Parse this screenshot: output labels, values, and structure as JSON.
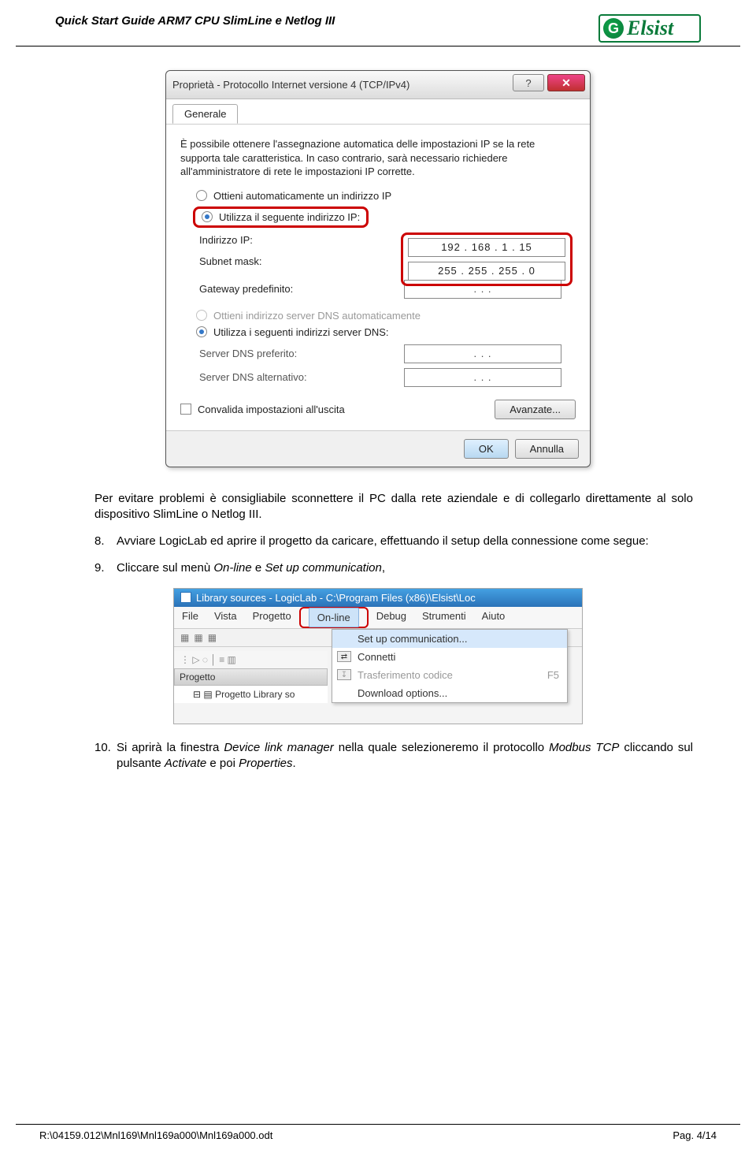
{
  "header": {
    "title": "Quick Start Guide ARM7 CPU SlimLine e Netlog III",
    "logo_text": "Elsist"
  },
  "dialog": {
    "title": "Proprietà - Protocollo Internet versione 4 (TCP/IPv4)",
    "tab": "Generale",
    "description": "È possibile ottenere l'assegnazione automatica delle impostazioni IP se la rete supporta tale caratteristica. In caso contrario, sarà necessario richiedere all'amministratore di rete le impostazioni IP corrette.",
    "radio_auto_ip": "Ottieni automaticamente un indirizzo IP",
    "radio_manual_ip": "Utilizza il seguente indirizzo IP:",
    "ip_label": "Indirizzo IP:",
    "ip_value": "192 . 168 .   1  .  15",
    "mask_label": "Subnet mask:",
    "mask_value": "255 . 255 . 255 .   0",
    "gw_label": "Gateway predefinito:",
    "gw_value": ".       .       .",
    "radio_auto_dns": "Ottieni indirizzo server DNS automaticamente",
    "radio_manual_dns": "Utilizza i seguenti indirizzi server DNS:",
    "dns1_label": "Server DNS preferito:",
    "dns1_value": ".       .       .",
    "dns2_label": "Server DNS alternativo:",
    "dns2_value": ".       .       .",
    "validate": "Convalida impostazioni all'uscita",
    "advanced": "Avanzate...",
    "ok": "OK",
    "cancel": "Annulla"
  },
  "para": {
    "p1a": "Per evitare problemi è consigliabile sconnettere il PC dalla rete aziendale e di collegarlo direttamente al solo dispositivo SlimLine o Netlog III.",
    "p8": "Avviare LogicLab ed aprire il progetto da caricare, effettuando il setup della connessione come segue:",
    "p9a": "Cliccare sul menù ",
    "p9b": "On-line",
    "p9c": " e ",
    "p9d": "Set up communication",
    "p9e": ",",
    "p10a": "Si aprirà la finestra ",
    "p10b": "Device link manager",
    "p10c": " nella quale selezioneremo il protocollo ",
    "p10d": "Modbus TCP",
    "p10e": " cliccando sul pulsante ",
    "p10f": "Activate",
    "p10g": " e poi ",
    "p10h": "Properties",
    "p10i": "."
  },
  "logiclab": {
    "title": "Library sources - LogicLab - C:\\Program Files (x86)\\Elsist\\Loc",
    "menu": {
      "file": "File",
      "vista": "Vista",
      "progetto": "Progetto",
      "online": "On-line",
      "debug": "Debug",
      "strumenti": "Strumenti",
      "aiuto": "Aiuto"
    },
    "dropdown": {
      "setup": "Set up communication...",
      "connect": "Connetti",
      "transfer": "Trasferimento codice",
      "transfer_key": "F5",
      "download": "Download options..."
    },
    "side": {
      "header": "Progetto",
      "row": "Progetto Library so"
    }
  },
  "footer": {
    "left": "R:\\04159.012\\Mnl169\\Mnl169a000\\Mnl169a000.odt",
    "right": "Pag. 4/14"
  }
}
